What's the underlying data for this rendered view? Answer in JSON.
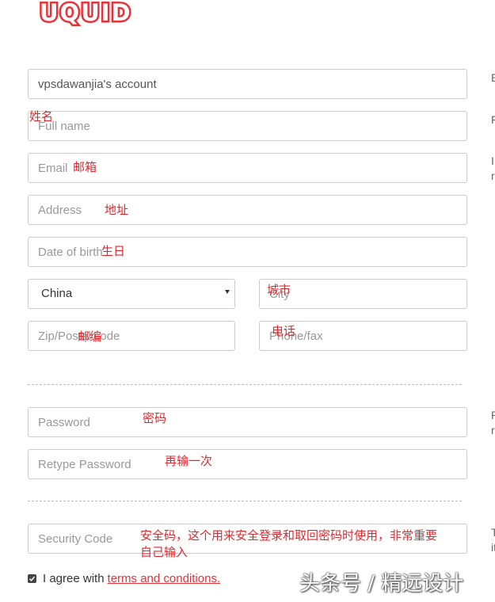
{
  "logo": {
    "text": "UQUID"
  },
  "form": {
    "account_value": "vpsdawanjia's account",
    "full_name_placeholder": "Full name",
    "email_placeholder": "Email",
    "address_placeholder": "Address",
    "dob_placeholder": "Date of birth",
    "country_selected": "China",
    "city_placeholder": "City",
    "zip_placeholder": "Zip/Postal code",
    "phone_placeholder": "Phone/fax",
    "password_placeholder": "Password",
    "retype_placeholder": "Retype Password",
    "security_placeholder": "Security Code"
  },
  "annotations": {
    "full_name": "姓名",
    "email": "邮箱",
    "address": "地址",
    "dob": "生日",
    "city": "城市",
    "zip": "邮编",
    "phone": "电话",
    "password": "密码",
    "retype": "再输一次",
    "security_line1": "安全码，这个用来安全登录和取回密码时使用，非常重要",
    "security_line2": "自己输入"
  },
  "side_text": {
    "account": "E",
    "full_name": "F",
    "email_1": "I",
    "email_2": "r",
    "password_1": "P",
    "password_2": "r",
    "security_1": "T",
    "security_2": "it"
  },
  "agree": {
    "text": "I agree with",
    "link": "terms and conditions."
  },
  "watermark": "头条号 / 精远设计",
  "colors": {
    "brand_red": "#e8323a",
    "annotation_red": "#e0282e"
  }
}
